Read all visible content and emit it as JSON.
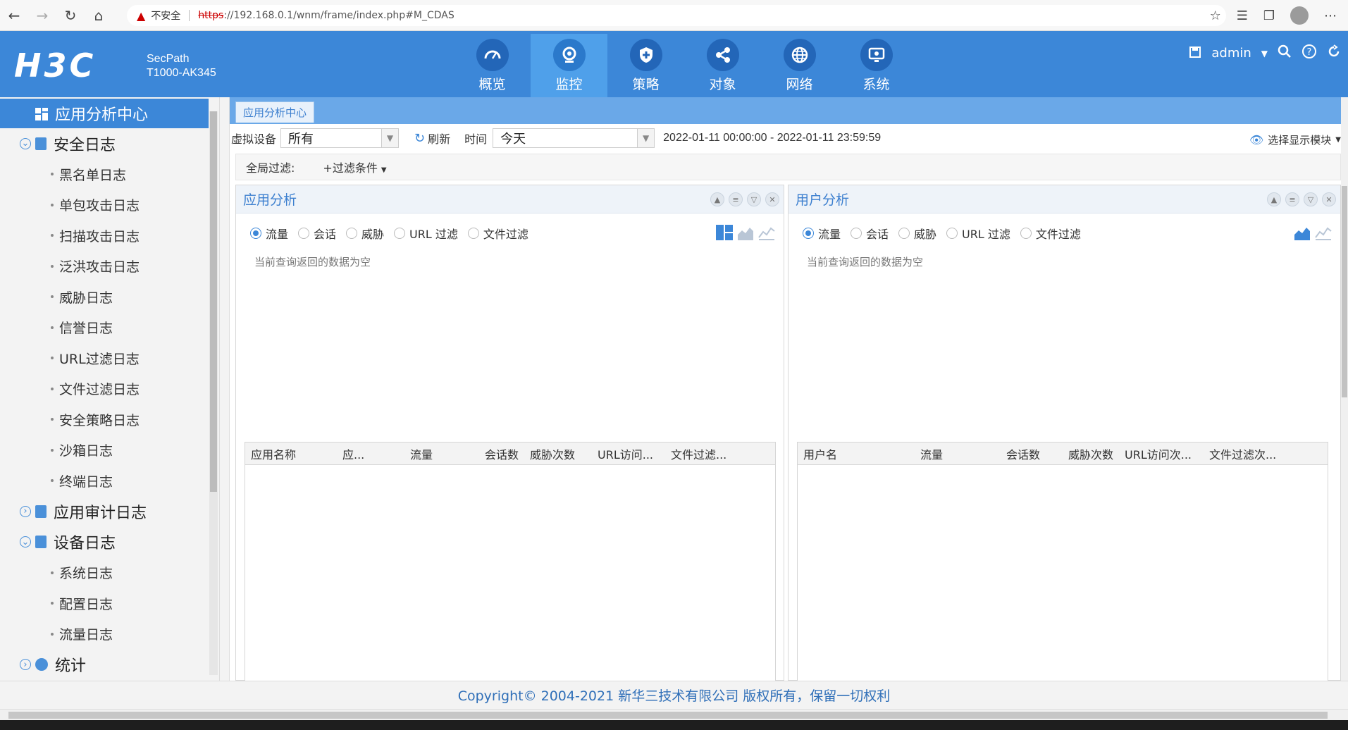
{
  "browser": {
    "security_label": "不安全",
    "url_scheme": "https",
    "url_rest": "://192.168.0.1/wnm/frame/index.php#M_CDAS"
  },
  "header": {
    "logo": "H3C",
    "model_line1": "SecPath",
    "model_line2": "T1000-AK345",
    "nav": [
      {
        "label": "概览",
        "icon": "gauge-icon"
      },
      {
        "label": "监控",
        "icon": "camera-icon"
      },
      {
        "label": "策略",
        "icon": "shield-icon"
      },
      {
        "label": "对象",
        "icon": "share-icon"
      },
      {
        "label": "网络",
        "icon": "globe-icon"
      },
      {
        "label": "系统",
        "icon": "monitor-icon"
      }
    ],
    "active_nav": "监控",
    "user": "admin"
  },
  "sidebar": {
    "title": "应用分析中心",
    "groups": [
      {
        "label": "安全日志",
        "items": [
          "黑名单日志",
          "单包攻击日志",
          "扫描攻击日志",
          "泛洪攻击日志",
          "威胁日志",
          "信誉日志",
          "URL过滤日志",
          "文件过滤日志",
          "安全策略日志",
          "沙箱日志",
          "终端日志"
        ]
      },
      {
        "label": "应用审计日志",
        "items": []
      },
      {
        "label": "设备日志",
        "items": [
          "系统日志",
          "配置日志",
          "流量日志"
        ]
      },
      {
        "label": "统计",
        "items": []
      }
    ]
  },
  "main": {
    "tab": "应用分析中心",
    "toolbar": {
      "vdevice_label": "虚拟设备",
      "vdevice_value": "所有",
      "refresh_label": "刷新",
      "time_label": "时间",
      "time_value": "今天",
      "range": "2022-01-11 00:00:00 - 2022-01-11 23:59:59",
      "display_module": "选择显示模块"
    },
    "filter": {
      "label": "全局过滤:",
      "add": "+过滤条件"
    },
    "panels": [
      {
        "title": "应用分析",
        "radios": [
          "流量",
          "会话",
          "威胁",
          "URL 过滤",
          "文件过滤"
        ],
        "selected": "流量",
        "empty": "当前查询返回的数据为空",
        "columns": [
          "应用名称",
          "应...",
          "流量",
          "会话数",
          "威胁次数",
          "URL访问...",
          "文件过滤..."
        ]
      },
      {
        "title": "用户分析",
        "radios": [
          "流量",
          "会话",
          "威胁",
          "URL 过滤",
          "文件过滤"
        ],
        "selected": "流量",
        "empty": "当前查询返回的数据为空",
        "columns": [
          "用户名",
          "流量",
          "会话数",
          "威胁次数",
          "URL访问次...",
          "文件过滤次..."
        ]
      }
    ]
  },
  "footer": {
    "copyright": "Copyright© 2004-2021 新华三技术有限公司 版权所有，保留一切权利"
  },
  "colors": {
    "header_blue": "#3c87d8",
    "active_nav": "#4fa0ea",
    "accent": "#3c7fcf"
  }
}
